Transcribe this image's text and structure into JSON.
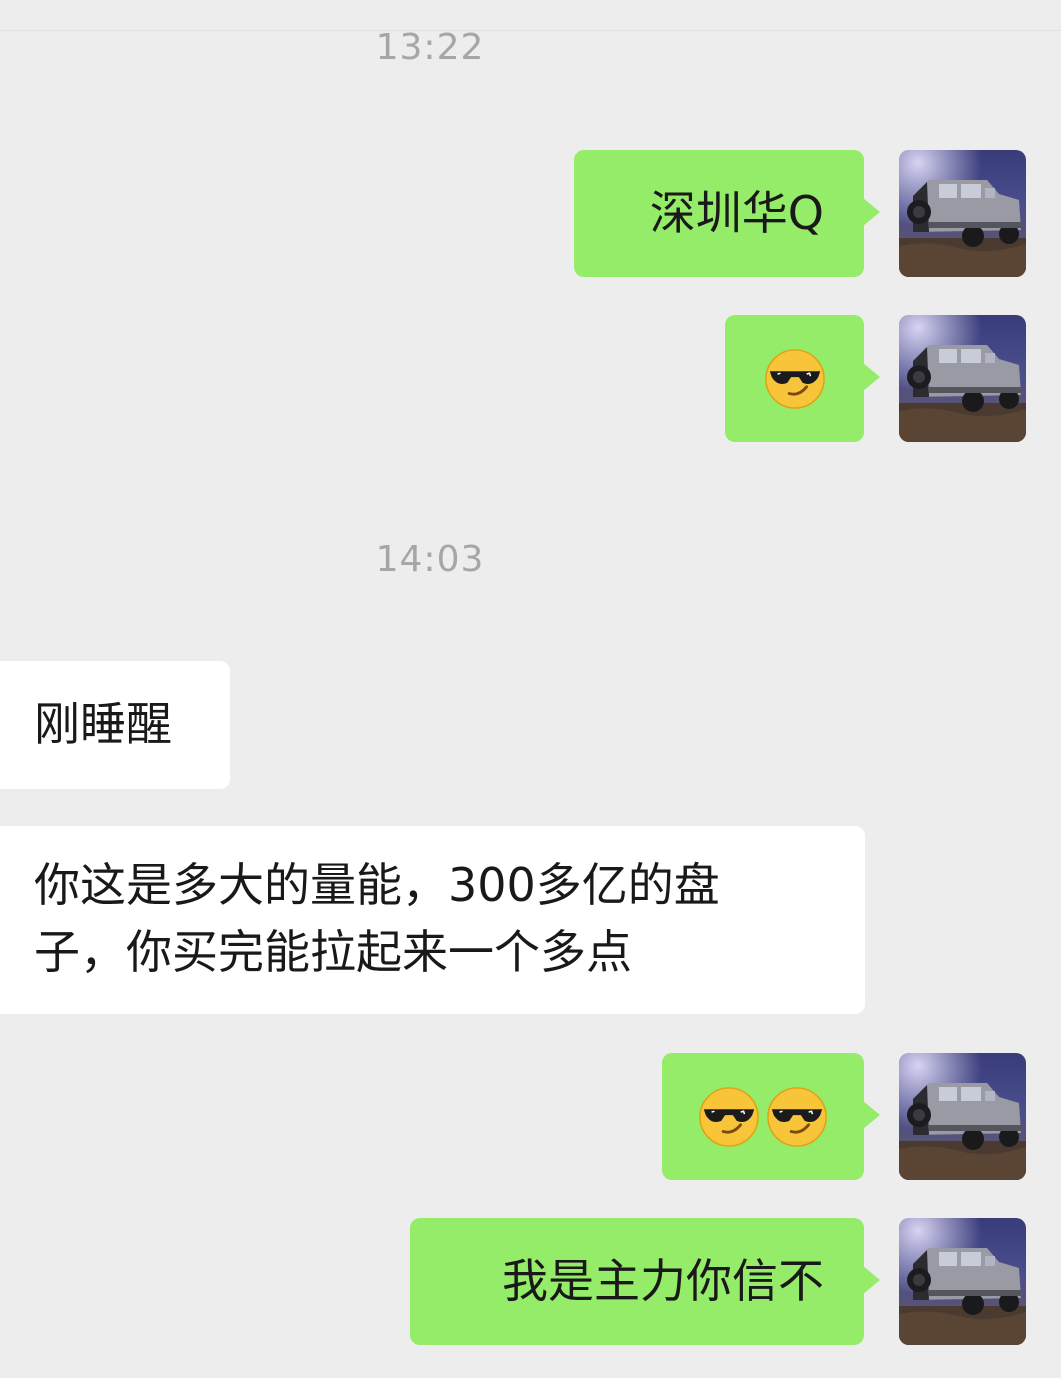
{
  "chat": {
    "messages": [
      {
        "type": "time",
        "text": "13:22"
      },
      {
        "type": "sent",
        "text": "深圳华Q"
      },
      {
        "type": "sent",
        "emoji": [
          "smiling-face-with-sunglasses"
        ]
      },
      {
        "type": "time",
        "text": "14:03"
      },
      {
        "type": "received",
        "text": "刚睡醒"
      },
      {
        "type": "received",
        "lines": [
          "你这是多大的量能，300多亿的盘",
          "子，你买完能拉起来一个多点"
        ]
      },
      {
        "type": "sent",
        "emoji": [
          "smiling-face-with-sunglasses",
          "smiling-face-with-sunglasses"
        ]
      },
      {
        "type": "sent",
        "text": "我是主力你信不"
      }
    ]
  },
  "avatar": {
    "icon": "car-avatar-icon"
  },
  "colors": {
    "background": "#ededed",
    "sent_bubble": "#95ec69",
    "received_bubble": "#ffffff",
    "timestamp": "#a6a6a6",
    "text": "#191919"
  }
}
